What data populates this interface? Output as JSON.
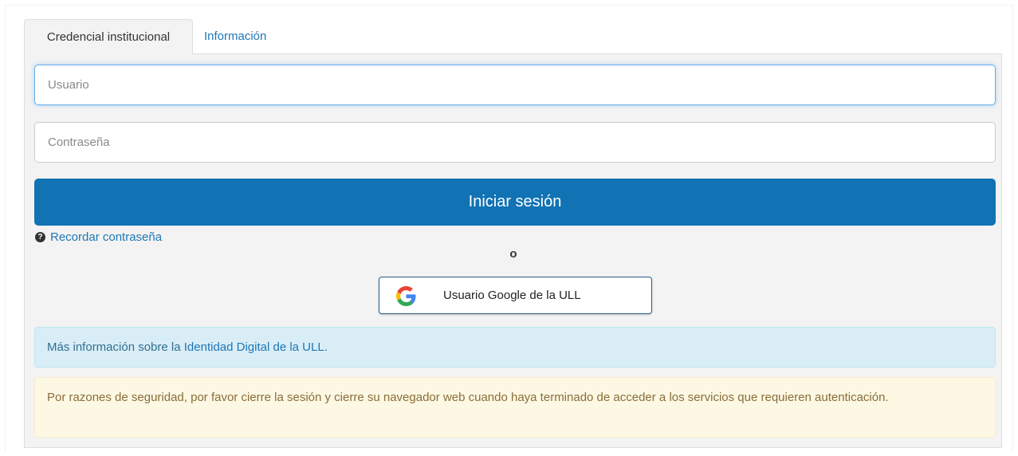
{
  "tabs": {
    "active_label": "Credencial institucional",
    "info_label": "Información"
  },
  "form": {
    "username_placeholder": "Usuario",
    "password_placeholder": "Contraseña",
    "login_label": "Iniciar sesión",
    "remember_label": "Recordar contraseña",
    "or_label": "o",
    "google_label": "Usuario Google de la ULL"
  },
  "info_alert": {
    "prefix": "Más información sobre la",
    "link": "Identidad Digital de la ULL",
    "suffix": "."
  },
  "warning_alert": {
    "text": "Por razones de seguridad, por favor cierre la sesión y cierre su navegador web cuando haya terminado de acceder a los servicios que requieren autenticación."
  },
  "icons": {
    "help": "question-circle-icon",
    "google": "google-g-icon"
  },
  "colors": {
    "primary": "#1172b4",
    "link": "#1f77b4",
    "info_bg": "#d9edf7",
    "warning_bg": "#fcf8e3"
  }
}
